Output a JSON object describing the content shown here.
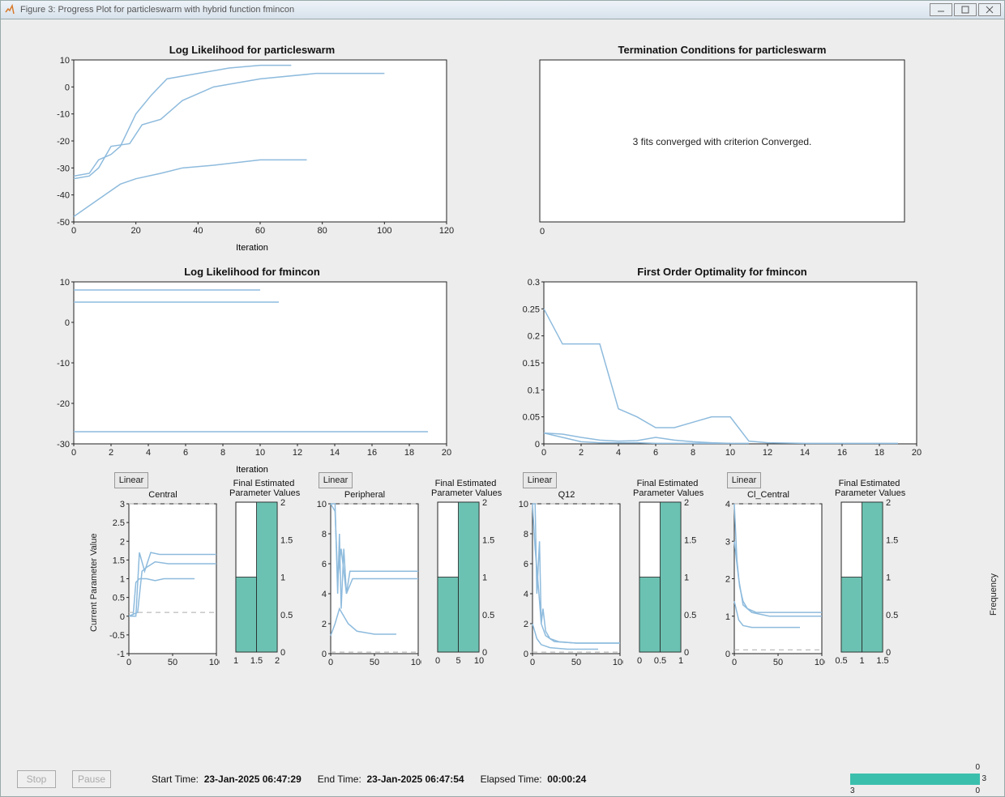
{
  "window": {
    "title": "Figure 3: Progress Plot for particleswarm with hybrid function fmincon"
  },
  "footer": {
    "stop": "Stop",
    "pause": "Pause",
    "start_label": "Start Time:",
    "start_value": "23-Jan-2025 06:47:29",
    "end_label": "End Time:",
    "end_value": "23-Jan-2025 06:47:54",
    "elapsed_label": "Elapsed Time:",
    "elapsed_value": "00:00:24",
    "pb_top": "0",
    "pb_right": "3",
    "pb_btm_l": "3",
    "pb_btm_r": "0"
  },
  "titles": {
    "c1": "Log Likelihood for particleswarm",
    "c2": "Termination Conditions for particleswarm",
    "c3": "Log Likelihood for fmincon",
    "c4": "First Order Optimality for fmincon",
    "c2_body": "3 fits converged with criterion Converged.",
    "c2_zero": "0",
    "xlab_iter": "Iteration",
    "linear": "Linear",
    "p_central": "Central",
    "p_peripheral": "Peripheral",
    "p_q12": "Q12",
    "p_cl": "Cl_Central",
    "hist": "Final Estimated\nParameter Values",
    "ylab_cpv": "Current Parameter Value",
    "ylab_freq": "Frequency"
  },
  "chart_data": [
    {
      "id": "c1",
      "type": "line",
      "title": "Log Likelihood for particleswarm",
      "xlabel": "Iteration",
      "ylabel": "",
      "xlim": [
        0,
        120
      ],
      "ylim": [
        -50,
        10
      ],
      "xticks": [
        0,
        20,
        40,
        60,
        80,
        100,
        120
      ],
      "yticks": [
        -50,
        -40,
        -30,
        -20,
        -10,
        0,
        10
      ],
      "series": [
        {
          "name": "fit1",
          "x": [
            0,
            5,
            8,
            12,
            15,
            20,
            25,
            30,
            40,
            50,
            60,
            70
          ],
          "y": [
            -33,
            -32,
            -27,
            -25,
            -22,
            -10,
            -3,
            3,
            5,
            7,
            8,
            8
          ]
        },
        {
          "name": "fit2",
          "x": [
            0,
            5,
            8,
            12,
            18,
            22,
            28,
            35,
            45,
            60,
            78,
            100
          ],
          "y": [
            -34,
            -33,
            -30,
            -22,
            -21,
            -14,
            -12,
            -5,
            0,
            3,
            5,
            5
          ]
        },
        {
          "name": "fit3",
          "x": [
            0,
            5,
            10,
            15,
            20,
            28,
            35,
            45,
            60,
            75
          ],
          "y": [
            -48,
            -44,
            -40,
            -36,
            -34,
            -32,
            -30,
            -29,
            -27,
            -27
          ]
        }
      ]
    },
    {
      "id": "c2",
      "type": "text",
      "title": "Termination Conditions for particleswarm",
      "text": "3 fits converged with criterion Converged."
    },
    {
      "id": "c3",
      "type": "line",
      "title": "Log Likelihood for fmincon",
      "xlabel": "Iteration",
      "ylabel": "",
      "xlim": [
        0,
        20
      ],
      "ylim": [
        -30,
        10
      ],
      "xticks": [
        0,
        2,
        4,
        6,
        8,
        10,
        12,
        14,
        16,
        18,
        20
      ],
      "yticks": [
        -30,
        -20,
        -10,
        0,
        10
      ],
      "series": [
        {
          "name": "fit1",
          "x": [
            0,
            2,
            4,
            6,
            8,
            10
          ],
          "y": [
            8,
            8,
            8,
            8,
            8,
            8
          ]
        },
        {
          "name": "fit2",
          "x": [
            0,
            2,
            4,
            6,
            8,
            10,
            11
          ],
          "y": [
            5,
            5,
            5,
            5,
            5,
            5,
            5
          ]
        },
        {
          "name": "fit3",
          "x": [
            0,
            2,
            4,
            6,
            8,
            10,
            12,
            14,
            16,
            18,
            19
          ],
          "y": [
            -27,
            -27,
            -27,
            -27,
            -27,
            -27,
            -27,
            -27,
            -27,
            -27,
            -27
          ]
        }
      ]
    },
    {
      "id": "c4",
      "type": "line",
      "title": "First Order Optimality for fmincon",
      "xlabel": "",
      "ylabel": "",
      "xlim": [
        0,
        20
      ],
      "ylim": [
        0,
        0.3
      ],
      "xticks": [
        0,
        2,
        4,
        6,
        8,
        10,
        12,
        14,
        16,
        18,
        20
      ],
      "yticks": [
        0,
        0.05,
        0.1,
        0.15,
        0.2,
        0.25,
        0.3
      ],
      "series": [
        {
          "name": "fit1",
          "x": [
            0,
            1,
            2,
            3,
            4,
            5,
            6,
            7,
            8,
            9,
            10,
            11,
            12,
            14,
            16,
            18,
            19
          ],
          "y": [
            0.25,
            0.185,
            0.185,
            0.185,
            0.065,
            0.05,
            0.03,
            0.03,
            0.04,
            0.05,
            0.05,
            0.005,
            0.002,
            0.001,
            0.001,
            0.001,
            0.001
          ]
        },
        {
          "name": "fit2",
          "x": [
            0,
            1,
            2,
            3,
            4,
            5,
            6,
            7,
            8,
            9,
            10,
            11
          ],
          "y": [
            0.02,
            0.018,
            0.012,
            0.007,
            0.005,
            0.006,
            0.012,
            0.007,
            0.004,
            0.002,
            0.001,
            0.001
          ]
        },
        {
          "name": "fit3",
          "x": [
            0,
            1,
            2,
            3,
            4,
            5,
            6,
            7,
            8,
            9,
            10
          ],
          "y": [
            0.02,
            0.012,
            0.004,
            0.002,
            0.002,
            0.002,
            0.001,
            0.001,
            0.001,
            0.001,
            0.001
          ]
        }
      ]
    },
    {
      "id": "p_central",
      "type": "line",
      "title": "Central",
      "xlim": [
        0,
        100
      ],
      "ylim": [
        -1,
        3
      ],
      "xticks": [
        0,
        50,
        100
      ],
      "yticks": [
        -1,
        -0.5,
        0,
        0.5,
        1,
        1.5,
        2,
        2.5,
        3
      ],
      "bounds": [
        0.1,
        10
      ],
      "series": [
        {
          "name": "s1",
          "x": [
            0,
            8,
            12,
            18,
            25,
            35,
            50,
            70,
            100
          ],
          "y": [
            0,
            0,
            1.7,
            1.2,
            1.7,
            1.65,
            1.65,
            1.65,
            1.65
          ]
        },
        {
          "name": "s2",
          "x": [
            0,
            10,
            15,
            20,
            30,
            45,
            60,
            100
          ],
          "y": [
            0,
            0.1,
            1.2,
            1.3,
            1.45,
            1.4,
            1.4,
            1.4
          ]
        },
        {
          "name": "s3",
          "x": [
            0,
            5,
            8,
            12,
            20,
            30,
            40,
            60,
            75
          ],
          "y": [
            0,
            0.05,
            0.9,
            1.0,
            1.0,
            0.95,
            1,
            1,
            1
          ]
        }
      ]
    },
    {
      "id": "h_central",
      "type": "bar",
      "title": "Final Estimated Parameter Values",
      "categories": [
        1,
        1.5,
        2
      ],
      "bins": [
        {
          "x": 1.25,
          "h": 1
        },
        {
          "x": 1.75,
          "h": 2
        }
      ],
      "ylim": [
        0,
        2
      ],
      "yticks": [
        0,
        0.5,
        1,
        1.5,
        2
      ],
      "xticks": [
        1,
        1.5,
        2
      ]
    },
    {
      "id": "p_peripheral",
      "type": "line",
      "title": "Peripheral",
      "xlim": [
        0,
        100
      ],
      "ylim": [
        0,
        10
      ],
      "xticks": [
        0,
        50,
        100
      ],
      "yticks": [
        0,
        2,
        4,
        6,
        8,
        10
      ],
      "bounds": [
        0.1,
        10
      ],
      "series": [
        {
          "name": "s1",
          "x": [
            0,
            5,
            8,
            10,
            12,
            15,
            18,
            22,
            30,
            50,
            70,
            100
          ],
          "y": [
            10,
            10,
            4,
            8,
            3,
            7,
            4,
            5.5,
            5.5,
            5.5,
            5.5,
            5.5
          ]
        },
        {
          "name": "s2",
          "x": [
            0,
            5,
            8,
            12,
            18,
            25,
            40,
            60,
            100
          ],
          "y": [
            10,
            9.5,
            5,
            7,
            4,
            5,
            5,
            5,
            5
          ]
        },
        {
          "name": "s3",
          "x": [
            0,
            5,
            10,
            15,
            20,
            30,
            50,
            75
          ],
          "y": [
            1.2,
            2,
            3,
            2.5,
            2,
            1.5,
            1.3,
            1.3
          ]
        }
      ]
    },
    {
      "id": "h_peripheral",
      "type": "bar",
      "title": "Final Estimated Parameter Values",
      "categories": [
        0,
        5,
        10
      ],
      "bins": [
        {
          "x": 2.5,
          "h": 1
        },
        {
          "x": 7.5,
          "h": 2
        }
      ],
      "ylim": [
        0,
        2
      ],
      "yticks": [
        0,
        0.5,
        1,
        1.5,
        2
      ],
      "xticks": [
        0,
        5,
        10
      ]
    },
    {
      "id": "p_q12",
      "type": "line",
      "title": "Q12",
      "xlim": [
        0,
        100
      ],
      "ylim": [
        0,
        10
      ],
      "xticks": [
        0,
        50,
        100
      ],
      "yticks": [
        0,
        2,
        4,
        6,
        8,
        10
      ],
      "bounds": [
        0.1,
        10
      ],
      "series": [
        {
          "name": "s1",
          "x": [
            0,
            3,
            5,
            8,
            10,
            12,
            15,
            20,
            30,
            50,
            70,
            100
          ],
          "y": [
            10,
            10,
            4,
            7.5,
            2,
            3,
            1.5,
            1,
            0.8,
            0.7,
            0.7,
            0.7
          ]
        },
        {
          "name": "s2",
          "x": [
            0,
            3,
            6,
            10,
            15,
            25,
            50,
            100
          ],
          "y": [
            10,
            7,
            5,
            2,
            1.2,
            0.8,
            0.7,
            0.7
          ]
        },
        {
          "name": "s3",
          "x": [
            0,
            5,
            10,
            20,
            40,
            60,
            75
          ],
          "y": [
            2,
            1,
            0.6,
            0.4,
            0.3,
            0.3,
            0.3
          ]
        }
      ]
    },
    {
      "id": "h_q12",
      "type": "bar",
      "title": "Final Estimated Parameter Values",
      "categories": [
        0,
        0.5,
        1
      ],
      "bins": [
        {
          "x": 0.25,
          "h": 1
        },
        {
          "x": 0.75,
          "h": 2
        }
      ],
      "ylim": [
        0,
        2
      ],
      "yticks": [
        0,
        0.5,
        1,
        1.5,
        2
      ],
      "xticks": [
        0,
        0.5,
        1
      ]
    },
    {
      "id": "p_cl",
      "type": "line",
      "title": "Cl_Central",
      "xlim": [
        0,
        100
      ],
      "ylim": [
        0,
        4
      ],
      "xticks": [
        0,
        50,
        100
      ],
      "yticks": [
        0,
        1,
        2,
        3,
        4
      ],
      "bounds": [
        0.1,
        10
      ],
      "series": [
        {
          "name": "s1",
          "x": [
            0,
            3,
            6,
            10,
            15,
            25,
            40,
            60,
            100
          ],
          "y": [
            4,
            2.5,
            1.8,
            1.4,
            1.2,
            1.1,
            1.1,
            1.1,
            1.1
          ]
        },
        {
          "name": "s2",
          "x": [
            0,
            5,
            10,
            20,
            40,
            70,
            100
          ],
          "y": [
            3,
            2,
            1.3,
            1.1,
            1,
            1,
            1
          ]
        },
        {
          "name": "s3",
          "x": [
            0,
            5,
            10,
            20,
            40,
            60,
            75
          ],
          "y": [
            1.4,
            0.9,
            0.75,
            0.7,
            0.7,
            0.7,
            0.7
          ]
        }
      ]
    },
    {
      "id": "h_cl",
      "type": "bar",
      "title": "Final Estimated Parameter Values",
      "categories": [
        0.5,
        1,
        1.5
      ],
      "bins": [
        {
          "x": 0.75,
          "h": 1
        },
        {
          "x": 1.25,
          "h": 2
        }
      ],
      "ylim": [
        0,
        2
      ],
      "yticks": [
        0,
        0.5,
        1,
        1.5,
        2
      ],
      "xticks": [
        0.5,
        1,
        1.5
      ]
    }
  ]
}
